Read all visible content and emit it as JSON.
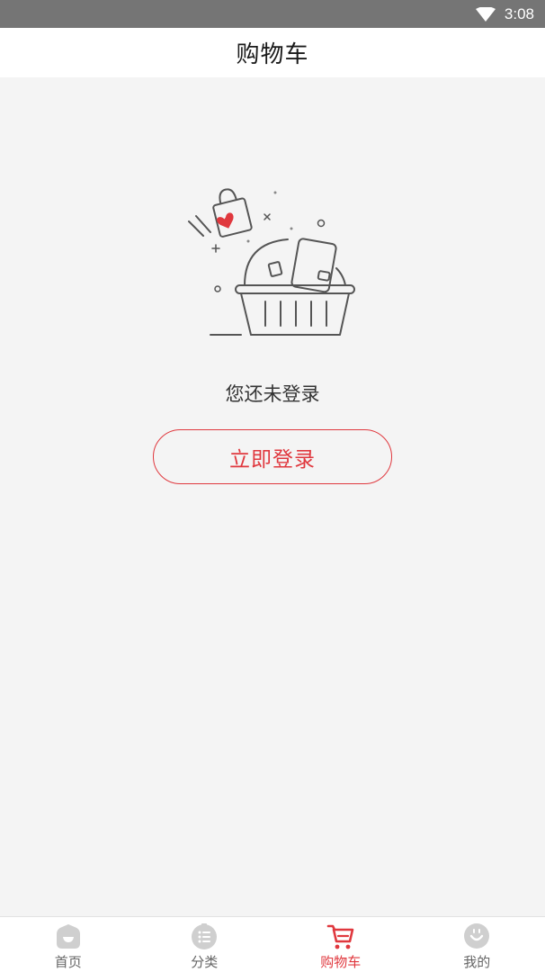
{
  "status_bar": {
    "time": "3:08",
    "icons": [
      "wifi-icon"
    ]
  },
  "header": {
    "title": "购物车"
  },
  "empty_state": {
    "illustration": "empty-basket-illustration",
    "message": "您还未登录",
    "login_button_label": "立即登录"
  },
  "tabs": [
    {
      "label": "首页",
      "icon": "home-icon",
      "active": false
    },
    {
      "label": "分类",
      "icon": "category-icon",
      "active": false
    },
    {
      "label": "购物车",
      "icon": "cart-icon",
      "active": true
    },
    {
      "label": "我的",
      "icon": "profile-icon",
      "active": false
    }
  ],
  "colors": {
    "accent": "#e0383e",
    "background": "#f4f4f4",
    "status_bar": "#757575",
    "tab_inactive": "#cfcfcf"
  }
}
